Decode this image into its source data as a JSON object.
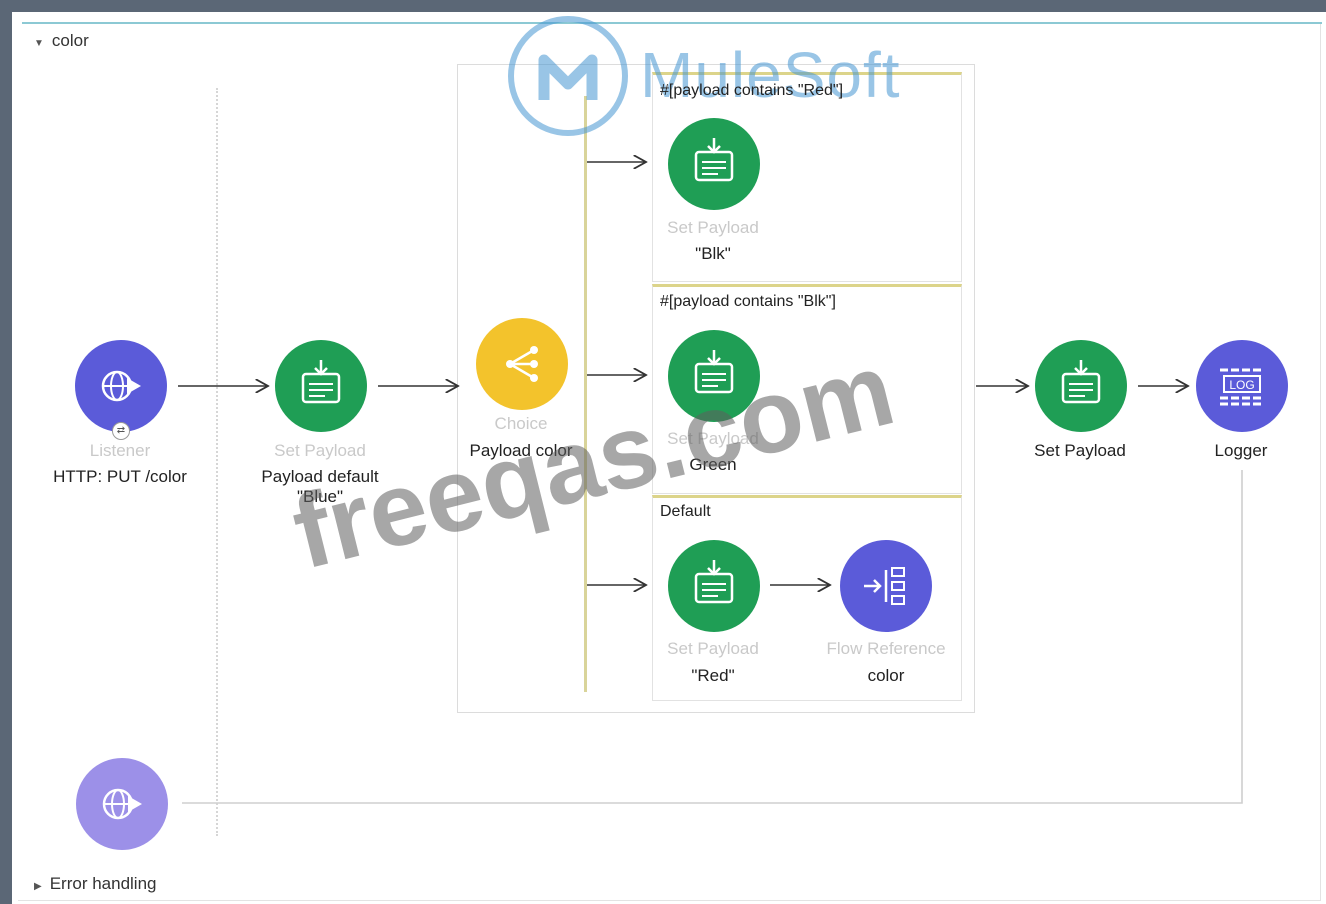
{
  "flow": {
    "name": "color",
    "error_handling_label": "Error handling"
  },
  "watermarks": {
    "brand": "MuleSoft",
    "site": "freeqas.com"
  },
  "components": {
    "listener": {
      "type": "Listener",
      "name": "HTTP: PUT /color",
      "icon": "http-listener-icon",
      "color": "#5b5bd9"
    },
    "set_payload_default": {
      "type": "Set Payload",
      "name": "Payload default\n\"Blue\"",
      "icon": "set-payload-icon",
      "color": "#1f9e55"
    },
    "choice": {
      "type": "Choice",
      "name": "Payload color",
      "icon": "choice-router-icon",
      "color": "#f3c32c"
    },
    "routes": [
      {
        "condition": "#[payload contains \"Red\"]",
        "set_payload": {
          "type": "Set Payload",
          "name": "\"Blk\""
        }
      },
      {
        "condition": "#[payload contains \"Blk\"]",
        "set_payload": {
          "type": "Set Payload",
          "name": "Green"
        }
      },
      {
        "condition": "Default",
        "set_payload": {
          "type": "Set Payload",
          "name": "\"Red\""
        },
        "flow_reference": {
          "type": "Flow Reference",
          "name": "color",
          "icon": "flow-reference-icon",
          "color": "#5b5bd9"
        }
      }
    ],
    "set_payload_after": {
      "name": "Set Payload",
      "icon": "set-payload-icon"
    },
    "logger": {
      "name": "Logger",
      "icon": "logger-icon",
      "badge": "LOG",
      "color": "#5b5bd9"
    },
    "response_icon": {
      "icon": "http-response-icon",
      "color": "#9c90e8"
    }
  }
}
